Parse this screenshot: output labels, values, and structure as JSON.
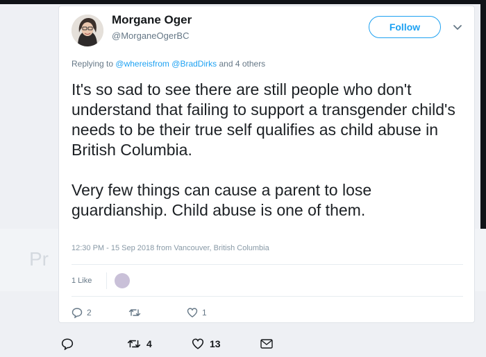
{
  "background": {
    "partial_text": "Pr"
  },
  "tweet": {
    "author": {
      "display_name": "Morgane Oger",
      "handle": "@MorganeOgerBC"
    },
    "follow_label": "Follow",
    "replying": {
      "prefix": "Replying to",
      "mention_1": "@whereisfrom",
      "mention_2": "@BradDirks",
      "suffix": "and 4 others"
    },
    "text": {
      "paragraph_1": "It's so sad to see there are still people who don't understand that failing to support a transgender child's needs to be their true self qualifies as child abuse in British Columbia.",
      "paragraph_2": "Very few things can cause a parent to lose guardianship. Child abuse is one of them."
    },
    "meta": "12:30 PM - 15 Sep 2018 from Vancouver, British Columbia",
    "likes_label": "1 Like",
    "actions": {
      "reply_count": "2",
      "retweet_count": "",
      "like_count": "1"
    }
  },
  "parent_actions": {
    "reply_count": "",
    "retweet_count": "4",
    "like_count": "13"
  },
  "colors": {
    "accent": "#1da1f2",
    "muted": "#657786",
    "border": "#e6ecf0"
  }
}
